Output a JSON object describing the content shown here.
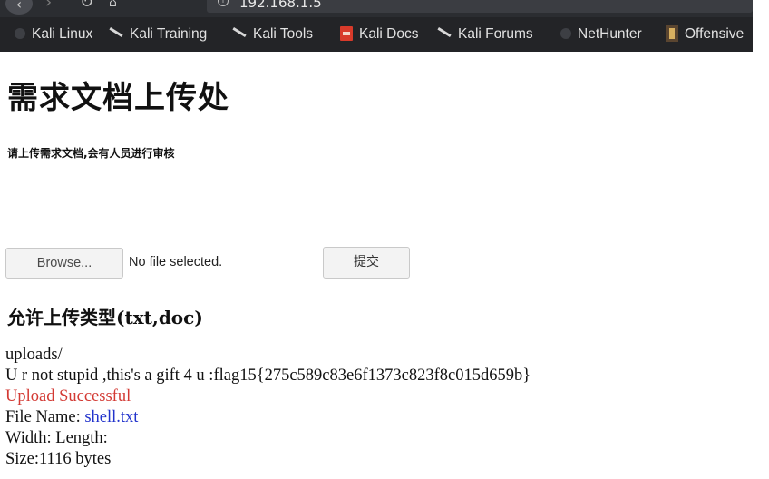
{
  "browser": {
    "back_glyph": "‹",
    "forward_glyph": "›",
    "reload_glyph": "↻",
    "home_glyph": "⌂",
    "address": "192.168.1.5",
    "bookmarks": [
      {
        "label": "Kali Linux",
        "icon": "kali-dragon-icon"
      },
      {
        "label": "Kali Training",
        "icon": "kali-training-icon"
      },
      {
        "label": "Kali Tools",
        "icon": "kali-tools-icon"
      },
      {
        "label": "Kali Docs",
        "icon": "kali-docs-icon"
      },
      {
        "label": "Kali Forums",
        "icon": "kali-forums-icon"
      },
      {
        "label": "NetHunter",
        "icon": "nethunter-icon"
      },
      {
        "label": "Offensive",
        "icon": "offensive-security-icon"
      }
    ]
  },
  "page": {
    "title": "需求文档上传处",
    "subtitle": "请上传需求文档,会有人员进行审核",
    "browse_label": "Browse...",
    "file_status": "No file selected.",
    "submit_label": "提交",
    "allowed_types": "允许上传类型(txt,doc)"
  },
  "result": {
    "dir": "uploads/",
    "gift_line": "U r not stupid ,this's a gift 4 u :flag15{275c589c83e6f1373c823f8c015d659b}",
    "status": "Upload Successful",
    "file_name_label": "File Name: ",
    "file_name": "shell.txt",
    "dimensions": "Width: Length:",
    "size": "Size:1116 bytes"
  },
  "colors": {
    "success": "#d33a34",
    "link": "#2233cc",
    "toolbar": "#2b2d31",
    "bookmarks_bar": "#232427"
  }
}
